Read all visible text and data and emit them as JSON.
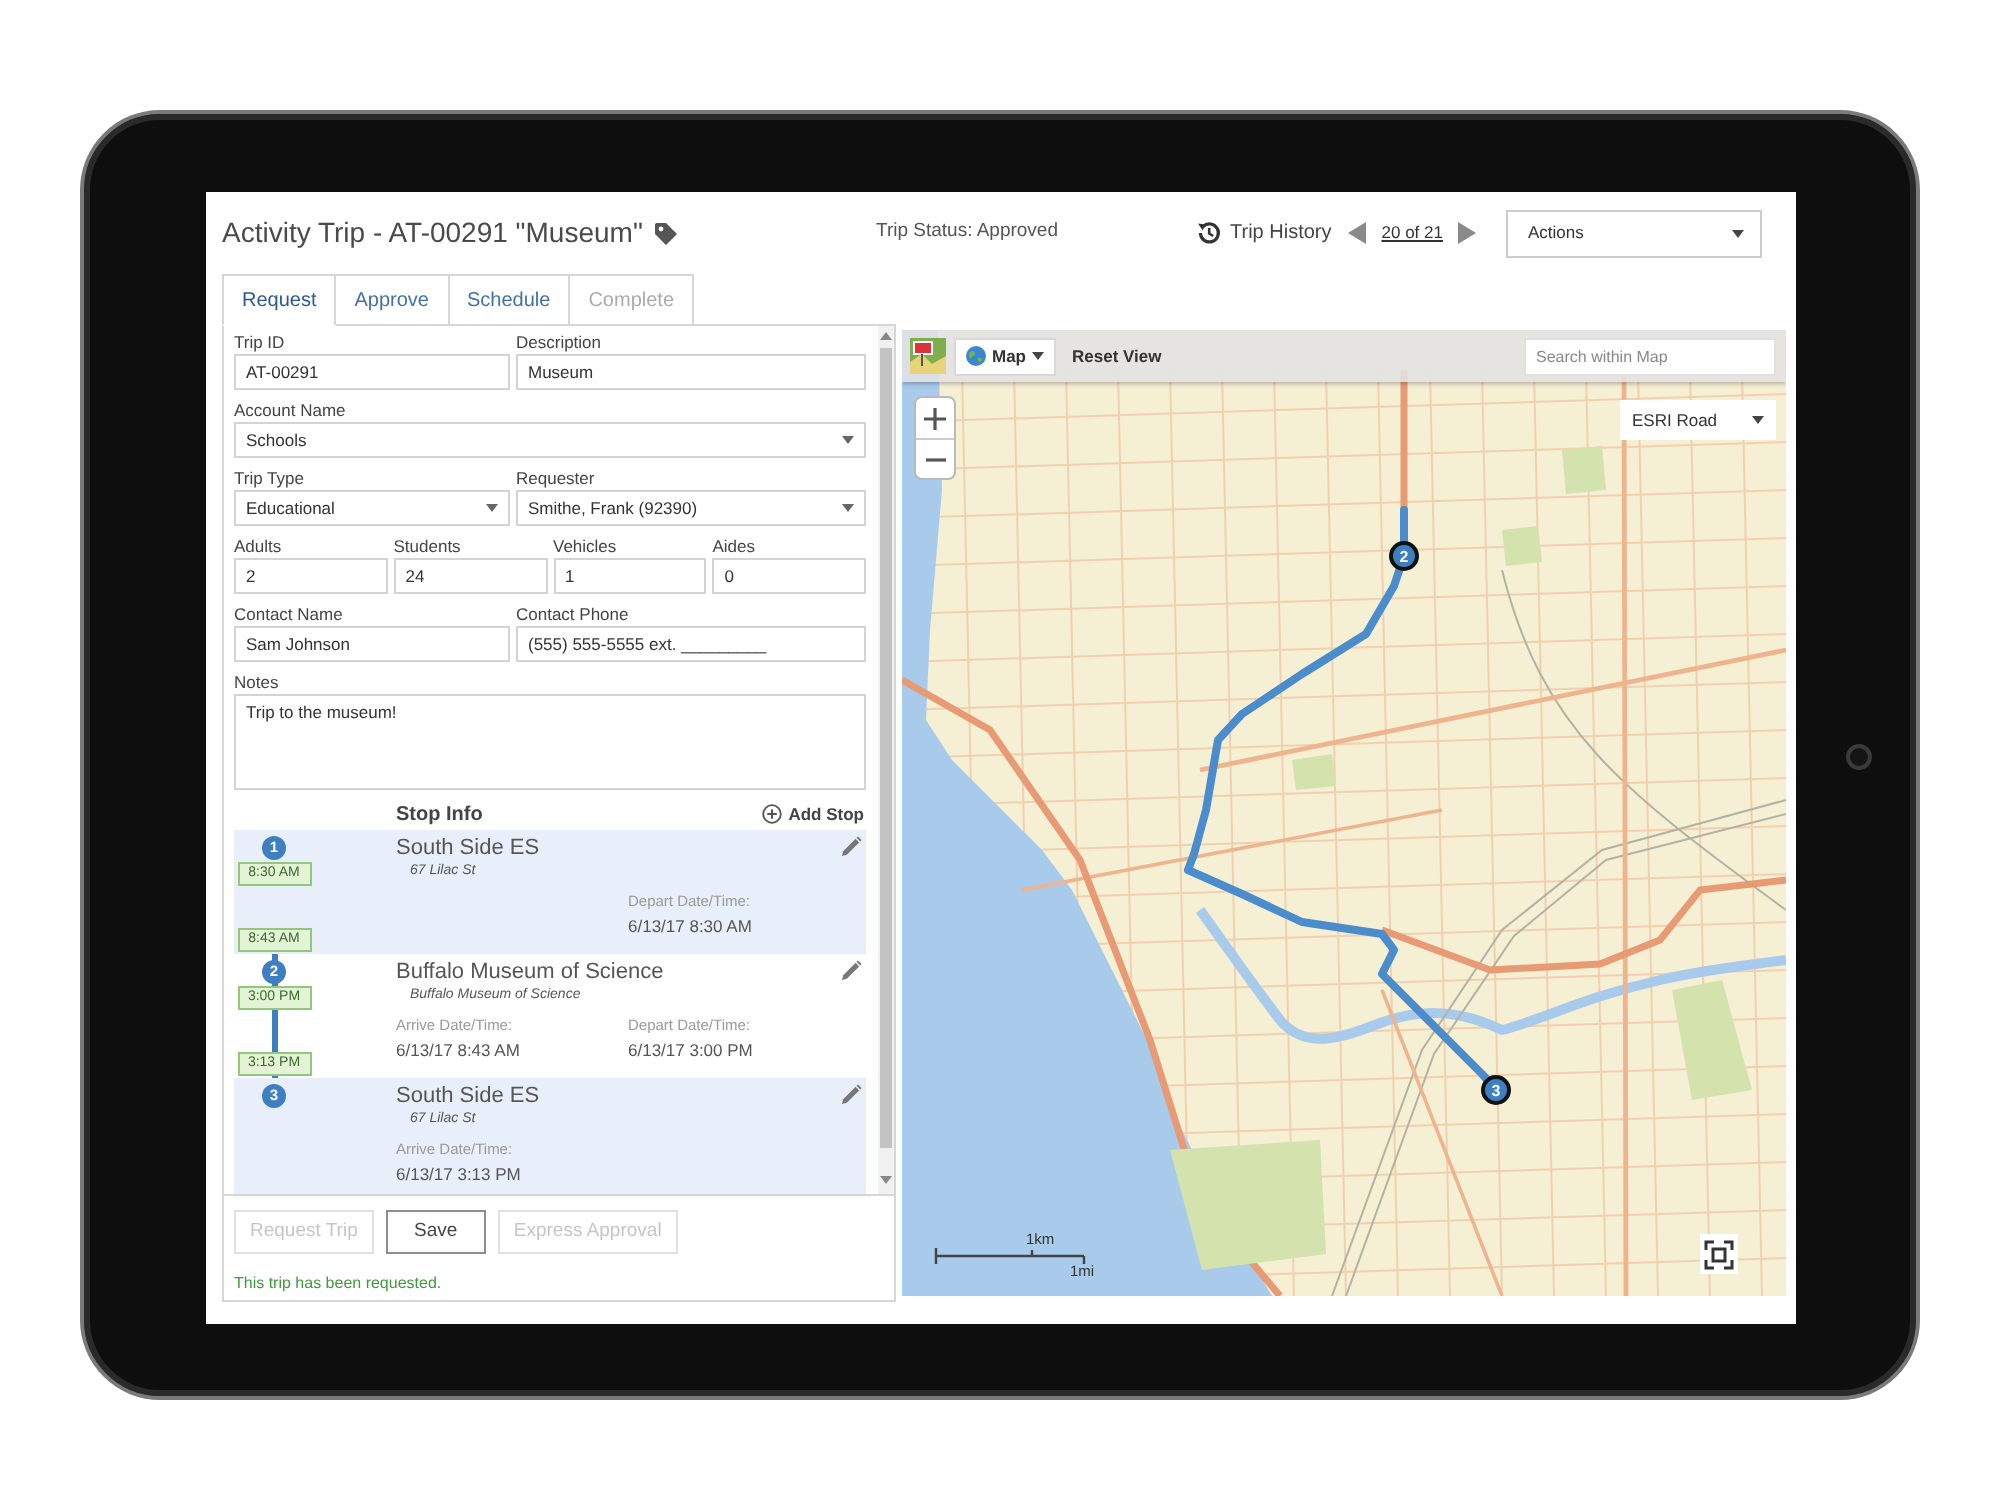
{
  "header": {
    "title": "Activity Trip - AT-00291 \"Museum\"",
    "status": "Trip Status: Approved",
    "history": "Trip History",
    "pager": "20 of 21",
    "actions": "Actions"
  },
  "tabs": [
    {
      "label": "Request",
      "selected": true,
      "disabled": false
    },
    {
      "label": "Approve",
      "selected": false,
      "disabled": false
    },
    {
      "label": "Schedule",
      "selected": false,
      "disabled": false
    },
    {
      "label": "Complete",
      "selected": false,
      "disabled": true
    }
  ],
  "form": {
    "rows": [
      [
        {
          "label": "Trip ID",
          "value": "AT-00291",
          "kind": "text"
        },
        {
          "label": "Description",
          "value": "Museum",
          "kind": "text"
        }
      ],
      [
        {
          "label": "Account Name",
          "value": "Schools",
          "kind": "select"
        }
      ],
      [
        {
          "label": "Trip Type",
          "value": "Educational",
          "kind": "select"
        },
        {
          "label": "Requester",
          "value": "Smithe, Frank (92390)",
          "kind": "select"
        }
      ],
      [
        {
          "label": "Adults",
          "value": "2",
          "kind": "text"
        },
        {
          "label": "Students",
          "value": "24",
          "kind": "text"
        },
        {
          "label": "Vehicles",
          "value": "1",
          "kind": "text"
        },
        {
          "label": "Aides",
          "value": "0",
          "kind": "text"
        }
      ],
      [
        {
          "label": "Contact Name",
          "value": "Sam Johnson",
          "kind": "text"
        },
        {
          "label": "Contact Phone",
          "value": "(555) 555-5555 ext. _________",
          "kind": "text"
        }
      ],
      [
        {
          "label": "Notes",
          "value": "Trip to the museum!",
          "kind": "textarea"
        }
      ]
    ]
  },
  "stops": {
    "title": "Stop Info",
    "add_label": "Add Stop",
    "items": [
      {
        "number": "1",
        "badges": [
          "8:30 AM",
          "8:43 AM"
        ],
        "name": "South Side ES",
        "address": "67 Lilac St",
        "depart": {
          "label": "Depart Date/Time:",
          "value": "6/13/17 8:30 AM"
        }
      },
      {
        "number": "2",
        "badges": [
          "3:00 PM",
          "3:13 PM"
        ],
        "name": "Buffalo Museum of Science",
        "address": "Buffalo Museum of Science",
        "arrive": {
          "label": "Arrive Date/Time:",
          "value": "6/13/17 8:43 AM"
        },
        "depart": {
          "label": "Depart Date/Time:",
          "value": "6/13/17 3:00 PM"
        }
      },
      {
        "number": "3",
        "name": "South Side ES",
        "address": "67 Lilac St",
        "arrive": {
          "label": "Arrive Date/Time:",
          "value": "6/13/17 3:13 PM"
        }
      }
    ]
  },
  "buttons": [
    {
      "label": "Request Trip",
      "disabled": true
    },
    {
      "label": "Save",
      "disabled": false
    },
    {
      "label": "Express Approval",
      "disabled": true
    }
  ],
  "message": "This trip has been requested.",
  "map": {
    "basemap": "Map",
    "reset": "Reset View",
    "search_placeholder": "Search within Map",
    "layer": "ESRI Road",
    "scale_km": "1km",
    "scale_mi": "1mi",
    "markers": [
      {
        "label": "2"
      },
      {
        "label": "3"
      }
    ]
  }
}
